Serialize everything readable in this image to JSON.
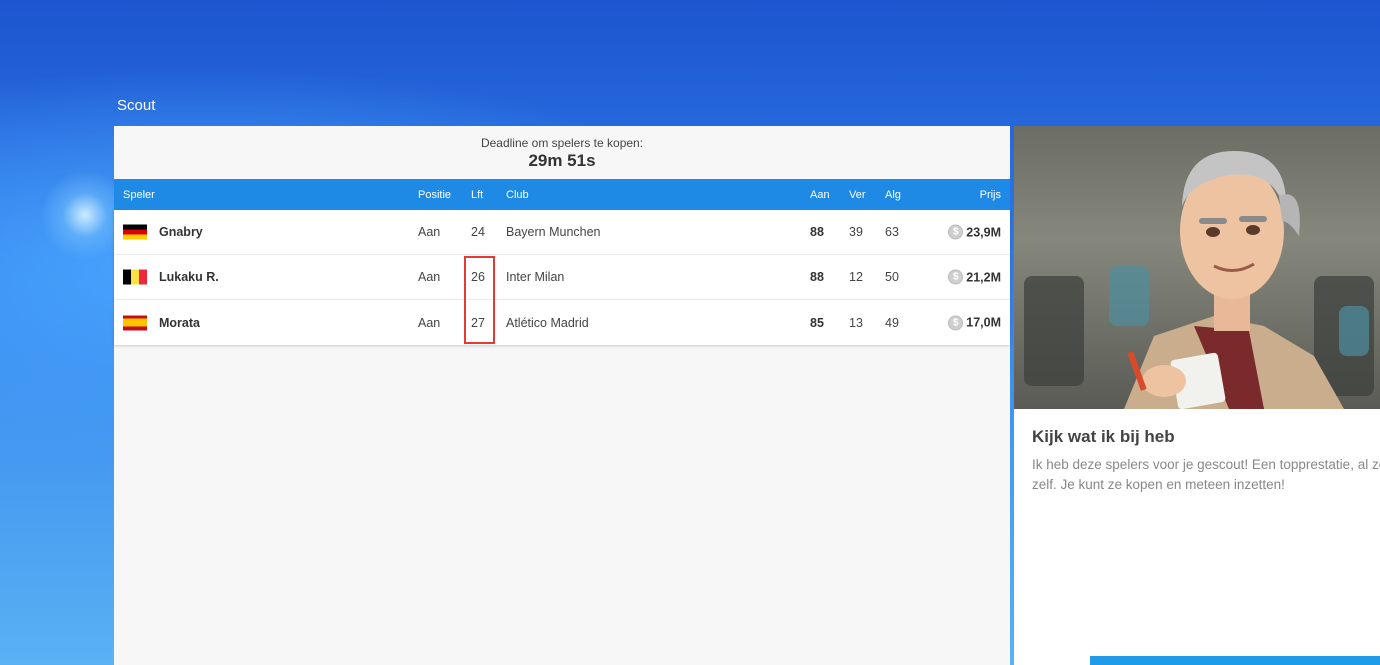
{
  "section_title": "Scout",
  "deadline": {
    "label": "Deadline om spelers te kopen:",
    "time": "29m 51s"
  },
  "table": {
    "headers": {
      "player": "Speler",
      "position": "Positie",
      "age": "Lft",
      "club": "Club",
      "attack": "Aan",
      "defense": "Ver",
      "overall": "Alg",
      "price": "Prijs"
    },
    "rows": [
      {
        "flag": "germany",
        "name": "Gnabry",
        "position": "Aan",
        "age": "24",
        "club": "Bayern Munchen",
        "attack": "88",
        "defense": "39",
        "overall": "63",
        "price": "23,9M"
      },
      {
        "flag": "belgium",
        "name": "Lukaku R.",
        "position": "Aan",
        "age": "26",
        "club": "Inter Milan",
        "attack": "88",
        "defense": "12",
        "overall": "50",
        "price": "21,2M"
      },
      {
        "flag": "spain",
        "name": "Morata",
        "position": "Aan",
        "age": "27",
        "club": "Atlético Madrid",
        "attack": "85",
        "defense": "13",
        "overall": "49",
        "price": "17,0M"
      }
    ],
    "coin_symbol": "$"
  },
  "side_card": {
    "title": "Kijk wat ik bij heb",
    "text_line1": "Ik heb deze spelers voor je gescout! Een topprestatie, al zeg ik het",
    "text_line2": "zelf. Je kunt ze kopen en meteen inzetten!"
  },
  "colors": {
    "header_blue": "#1f8ae6",
    "highlight_red": "#e53935",
    "accent_blue": "#1f9be8"
  }
}
